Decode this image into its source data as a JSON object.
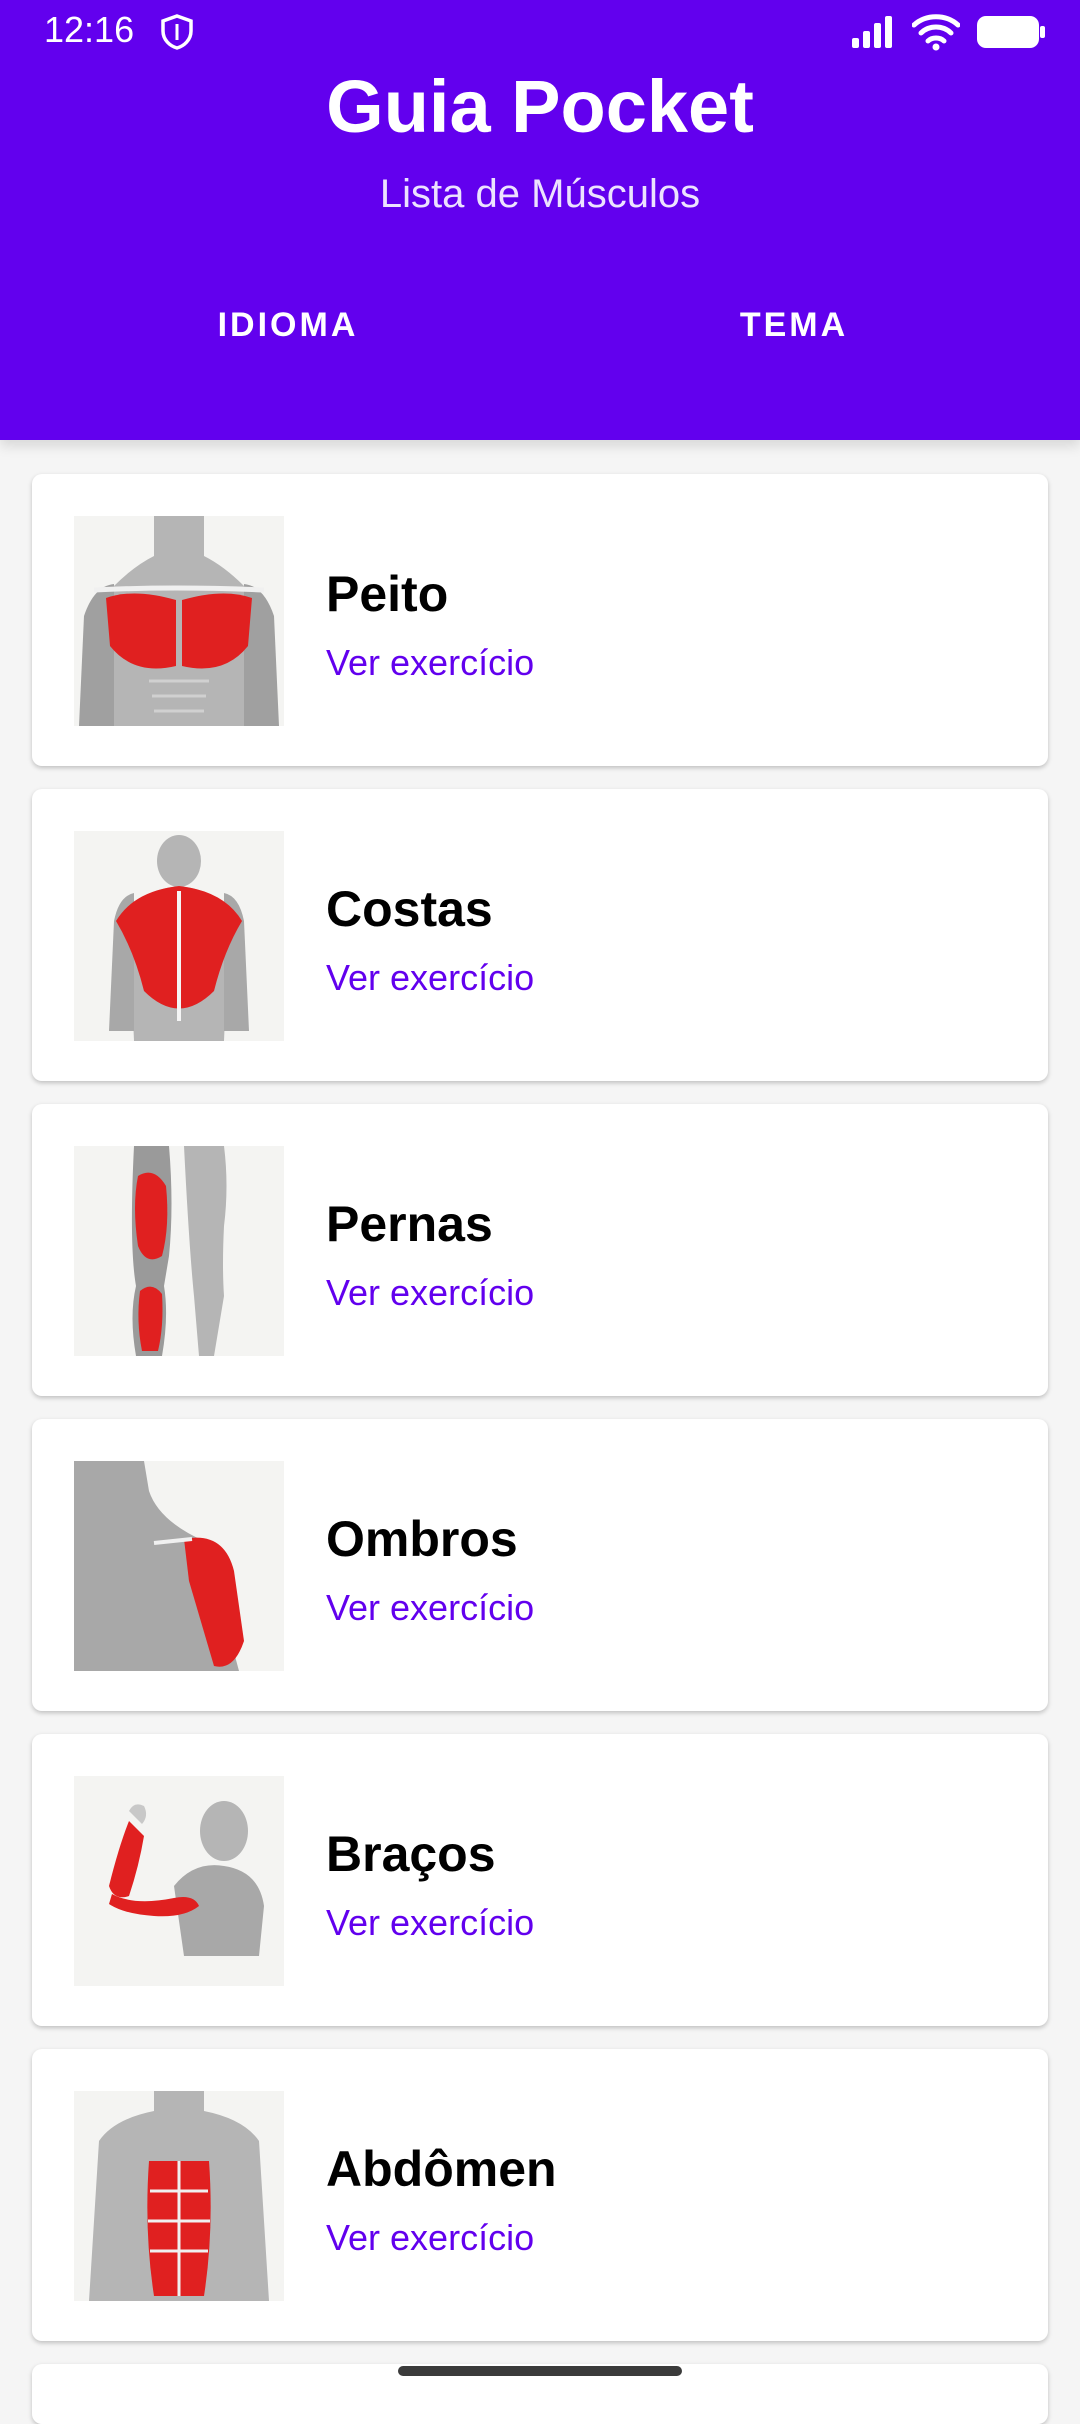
{
  "status_bar": {
    "time": "12:16",
    "icons": [
      "shield-icon",
      "signal-icon",
      "wifi-icon",
      "battery-icon"
    ]
  },
  "header": {
    "title": "Guia Pocket",
    "subtitle": "Lista de Músculos",
    "tabs": [
      {
        "label": "IDIOMA"
      },
      {
        "label": "TEMA"
      }
    ]
  },
  "muscles": [
    {
      "name": "Peito",
      "link": "Ver exercício",
      "icon": "chest-muscles-icon"
    },
    {
      "name": "Costas",
      "link": "Ver exercício",
      "icon": "back-muscles-icon"
    },
    {
      "name": "Pernas",
      "link": "Ver exercício",
      "icon": "leg-muscles-icon"
    },
    {
      "name": "Ombros",
      "link": "Ver exercício",
      "icon": "shoulder-muscles-icon"
    },
    {
      "name": "Braços",
      "link": "Ver exercício",
      "icon": "arm-muscles-icon"
    },
    {
      "name": "Abdômen",
      "link": "Ver exercício",
      "icon": "abdomen-muscles-icon"
    }
  ],
  "colors": {
    "primary": "#6200EE",
    "muscle_red": "#e02020",
    "body_gray": "#a9a9a9"
  }
}
